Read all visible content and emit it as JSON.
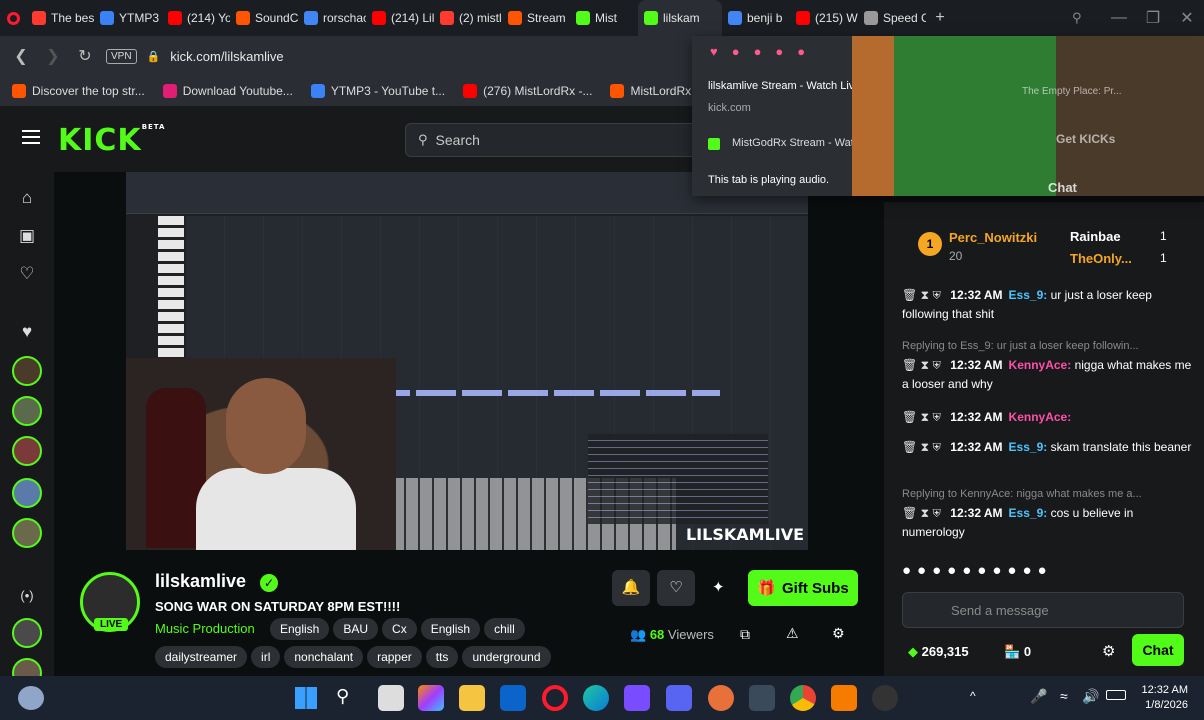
{
  "browser": {
    "tabs": [
      {
        "label": "The best",
        "color": "#ff3b30"
      },
      {
        "label": "YTMP3",
        "color": "#3b82f6"
      },
      {
        "label": "(214) Yo",
        "color": "#ff0000"
      },
      {
        "label": "SoundC",
        "color": "#ff5500"
      },
      {
        "label": "rorschac",
        "color": "#4285f4"
      },
      {
        "label": "(214) Lil",
        "color": "#ff0000"
      },
      {
        "label": "(2) mistl",
        "color": "#ff3b30"
      },
      {
        "label": "Stream",
        "color": "#ff5500"
      },
      {
        "label": "Mist",
        "color": "#53fc18"
      },
      {
        "label": "lilskam",
        "color": "#53fc18",
        "active": true
      },
      {
        "label": "benji b",
        "color": "#4285f4"
      },
      {
        "label": "(215) W",
        "color": "#ff0000"
      },
      {
        "label": "Speed C",
        "color": "#999999"
      }
    ],
    "vpn_label": "VPN",
    "url": "kick.com/lilskamlive",
    "bookmarks": [
      {
        "label": "Discover the top str...",
        "color": "#ff5500"
      },
      {
        "label": "Download Youtube...",
        "color": "#e11d74"
      },
      {
        "label": "YTMP3 - YouTube t...",
        "color": "#3b82f6"
      },
      {
        "label": "(276) MistLordRx -...",
        "color": "#ff0000"
      },
      {
        "label": "MistLordRx idek...",
        "color": "#ff5500"
      }
    ],
    "hover_popup": {
      "title": "lilskamlive Stream - Watch Live on Kick",
      "domain": "kick.com",
      "second_tab": "MistGodRx Stream - Watch Live on Kick",
      "note": "This tab is playing audio."
    }
  },
  "kick": {
    "search_placeholder": "Search",
    "get_kicks": "Get KICKs",
    "empty_place": "The Empty Place: Pr...",
    "chat_header": "Chat",
    "watermark": "LILSKAMLIVE",
    "channel": {
      "name": "lilskamlive",
      "title": "SONG WAR ON SATURDAY 8PM EST!!!!",
      "category": "Music Production",
      "live_badge": "LIVE",
      "tags_row1": [
        "English",
        "BAU",
        "Cx",
        "English",
        "chill"
      ],
      "tags_row2": [
        "dailystreamer",
        "irl",
        "nonchalant",
        "rapper",
        "tts",
        "underground"
      ],
      "viewers_count": "68",
      "viewers_label": "Viewers",
      "gift_subs": "Gift Subs"
    },
    "leaderboard": [
      {
        "rank": "1",
        "name": "Perc_Nowitzki",
        "points": "20"
      },
      {
        "name": "Rainbae",
        "count": "1"
      },
      {
        "name": "TheOnly...",
        "count": "1"
      }
    ],
    "chat": [
      {
        "time": "12:32 AM",
        "user": "Ess_9:",
        "text": "ur just a loser keep following that shit"
      },
      {
        "reply": "Replying to Ess_9: ur just a loser keep followin..."
      },
      {
        "time": "12:32 AM",
        "user": "KennyAce:",
        "text": "nigga what makes me a looser and why"
      },
      {
        "time": "12:32 AM",
        "user": "KennyAce:",
        "text": ""
      },
      {
        "time": "12:32 AM",
        "user": "Ess_9:",
        "text": "skam translate this beaner"
      },
      {
        "reply": "Replying to KennyAce: nigga what makes me a..."
      },
      {
        "time": "12:32 AM",
        "user": "Ess_9:",
        "text": "cos u believe in numerology"
      }
    ],
    "send_placeholder": "Send a message",
    "kicks_balance": "269,315",
    "store_count": "0",
    "chat_button": "Chat",
    "colors": {
      "brand": "#53fc18",
      "username_green": "#53fc18",
      "username_pink": "#ff4fa8",
      "gold": "#f5a623"
    }
  },
  "taskbar": {
    "time": "12:32 AM",
    "date": "1/8/2026"
  }
}
